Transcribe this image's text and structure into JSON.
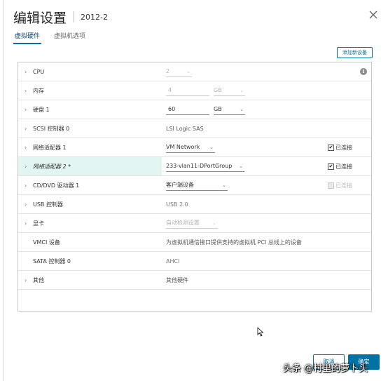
{
  "header": {
    "title": "编辑设置",
    "subtitle": "2012-2"
  },
  "tabs": [
    {
      "label": "虚拟硬件",
      "active": true
    },
    {
      "label": "虚拟机选项",
      "active": false
    }
  ],
  "toolbar": {
    "add_device_label": "添加新设备"
  },
  "hardware": {
    "cpu": {
      "label": "CPU",
      "value": "2"
    },
    "memory": {
      "label": "内存",
      "value": "4",
      "unit": "GB"
    },
    "disk": {
      "label": "硬盘 1",
      "value": "60",
      "unit": "GB"
    },
    "scsi": {
      "label": "SCSI 控制器 0",
      "value": "LSI Logic SAS"
    },
    "nic1": {
      "label": "网络适配器 1",
      "value": "VM Network",
      "connected_label": "已连接",
      "connected": true
    },
    "nic2": {
      "label": "网络适配器 2 *",
      "value": "233-vlan11-DPortGroup",
      "connected_label": "已连接",
      "connected": true
    },
    "cddvd": {
      "label": "CD/DVD 驱动器 1",
      "value": "客户端设备",
      "connected_label": "已连接",
      "connected": false
    },
    "usb": {
      "label": "USB 控制器",
      "value": "USB 2.0"
    },
    "video": {
      "label": "显卡",
      "value": "自动检测设置"
    },
    "vmci": {
      "label": "VMCI 设备",
      "value": "为虚拟机通信接口提供支持的虚拟机 PCI 总线上的设备"
    },
    "sata": {
      "label": "SATA 控制器 0",
      "value": "AHCI"
    },
    "other": {
      "label": "其他",
      "value": "其他硬件"
    }
  },
  "footer": {
    "cancel_label": "取消",
    "ok_label": "确定"
  },
  "watermark": "头条 @村里的萝卜头",
  "icons": {
    "close": "close-icon",
    "info": "info-icon",
    "chevron": "chevron-right-icon",
    "caret": "chevron-down-icon"
  },
  "colors": {
    "accent": "#0072a3",
    "highlight_row": "#e3f5f2"
  }
}
